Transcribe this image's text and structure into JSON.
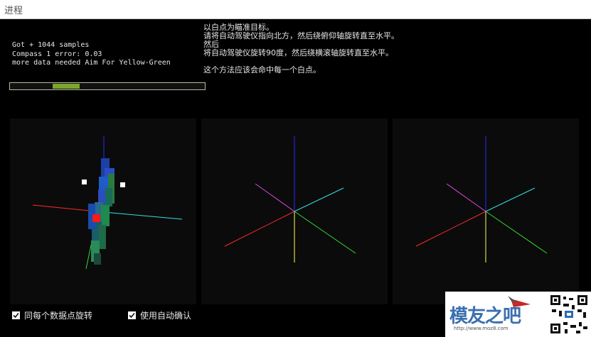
{
  "window": {
    "title": "进程"
  },
  "status": {
    "lines": [
      "Got + 1044 samples",
      "Compass 1 error: 0.03",
      "more data needed Aim For Yellow-Green"
    ]
  },
  "progress": {
    "fraction": 0.36,
    "segment_start": 0.22,
    "segment_end": 0.36
  },
  "instructions": {
    "lines": [
      "以白点为瞄准目标。",
      "请将自动驾驶仪指向北方，然后绕俯仰轴旋转直至水平。",
      "然后",
      "将自动驾驶仪旋转90度，然后绕横滚轴旋转直至水平。",
      "",
      "这个方法应该会命中每一个白点。"
    ]
  },
  "panels": [
    {
      "name": "panel-samples"
    },
    {
      "name": "panel-view-2"
    },
    {
      "name": "panel-view-3"
    }
  ],
  "axis_colors": {
    "x": "#ff2a2a",
    "y": "#2a2aff",
    "z": "#ffff55",
    "neg_x": "#33e0e0",
    "neg_y": "#e04be0",
    "neg_z": "#33dd33"
  },
  "options": {
    "rotate_each_point": {
      "label": "同每个数据点旋转",
      "checked": true
    },
    "auto_accept": {
      "label": "使用自动确认",
      "checked": true
    }
  },
  "watermark": {
    "text": "模友之吧",
    "sub": "http://www.moz8.com"
  }
}
